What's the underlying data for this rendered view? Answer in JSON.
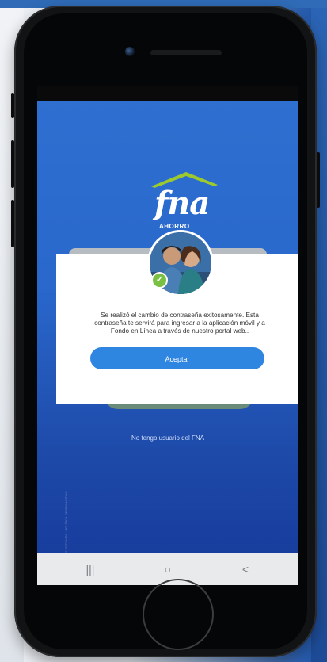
{
  "screen": {
    "logo": {
      "brand": "fna",
      "tagline": "AHORRO"
    },
    "side_text": "REDES SOCIALES · POLÍTICA DE PRIVACIDAD",
    "dialog": {
      "message": "Se realizó el cambio de contraseña exitosamente. Esta contraseña te servirá para ingresar a la aplicación móvil y a Fondo en Línea a través de nuestro portal web..",
      "accept_label": "Aceptar"
    },
    "no_user_link": "No tengo usuario del FNA",
    "nav": {
      "recent": "|||",
      "home": "○",
      "back": "<"
    }
  },
  "colors": {
    "accent": "#2f86e0",
    "success": "#7ac143",
    "background": "#2a68cc"
  }
}
